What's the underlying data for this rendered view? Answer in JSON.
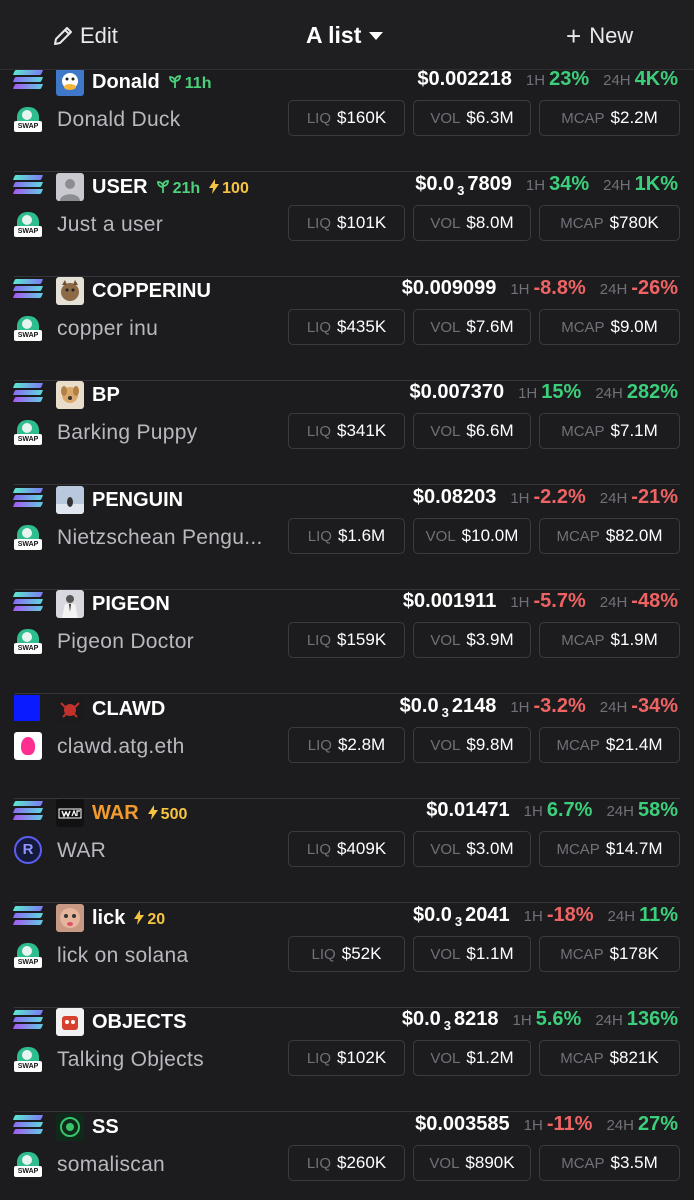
{
  "header": {
    "edit_label": "Edit",
    "list_label": "A list",
    "new_label": "New"
  },
  "labels": {
    "h1": "1H",
    "h24": "24H",
    "liq": "LIQ",
    "vol": "VOL",
    "mcap": "MCAP",
    "swap": "SWAP"
  },
  "tokens": [
    {
      "symbol": "Donald",
      "age": "11h",
      "boost": "",
      "name": "Donald Duck",
      "price_main": "$0.002218",
      "price_sub": "",
      "price_tail": "",
      "h1": "23%",
      "h24": "4K%",
      "liq": "$160K",
      "vol": "$6.3M",
      "mcap": "$2.2M",
      "dex": "swap",
      "chain": "solana"
    },
    {
      "symbol": "USER",
      "age": "21h",
      "boost": "100",
      "name": "Just a user",
      "price_main": "$0.0",
      "price_sub": "3",
      "price_tail": "7809",
      "h1": "34%",
      "h24": "1K%",
      "liq": "$101K",
      "vol": "$8.0M",
      "mcap": "$780K",
      "dex": "swap",
      "chain": "solana"
    },
    {
      "symbol": "COPPERINU",
      "age": "",
      "boost": "",
      "name": "copper inu",
      "price_main": "$0.009099",
      "price_sub": "",
      "price_tail": "",
      "h1": "-8.8%",
      "h24": "-26%",
      "liq": "$435K",
      "vol": "$7.6M",
      "mcap": "$9.0M",
      "dex": "swap",
      "chain": "solana"
    },
    {
      "symbol": "BP",
      "age": "",
      "boost": "",
      "name": "Barking Puppy",
      "price_main": "$0.007370",
      "price_sub": "",
      "price_tail": "",
      "h1": "15%",
      "h24": "282%",
      "liq": "$341K",
      "vol": "$6.6M",
      "mcap": "$7.1M",
      "dex": "swap",
      "chain": "solana"
    },
    {
      "symbol": "PENGUIN",
      "age": "",
      "boost": "",
      "name": "Nietzschean Pengu...",
      "price_main": "$0.08203",
      "price_sub": "",
      "price_tail": "",
      "h1": "-2.2%",
      "h24": "-21%",
      "liq": "$1.6M",
      "vol": "$10.0M",
      "mcap": "$82.0M",
      "dex": "swap",
      "chain": "solana"
    },
    {
      "symbol": "PIGEON",
      "age": "",
      "boost": "",
      "name": "Pigeon Doctor",
      "price_main": "$0.001911",
      "price_sub": "",
      "price_tail": "",
      "h1": "-5.7%",
      "h24": "-48%",
      "liq": "$159K",
      "vol": "$3.9M",
      "mcap": "$1.9M",
      "dex": "swap",
      "chain": "solana"
    },
    {
      "symbol": "CLAWD",
      "age": "",
      "boost": "",
      "name": "clawd.atg.eth",
      "price_main": "$0.0",
      "price_sub": "3",
      "price_tail": "2148",
      "h1": "-3.2%",
      "h24": "-34%",
      "liq": "$2.8M",
      "vol": "$9.8M",
      "mcap": "$21.4M",
      "dex": "uniswap",
      "chain": "base"
    },
    {
      "symbol": "WAR",
      "age": "",
      "boost": "500",
      "name": "WAR",
      "price_main": "$0.01471",
      "price_sub": "",
      "price_tail": "",
      "h1": "6.7%",
      "h24": "58%",
      "liq": "$409K",
      "vol": "$3.0M",
      "mcap": "$14.7M",
      "dex": "raydium",
      "chain": "solana"
    },
    {
      "symbol": "lick",
      "age": "",
      "boost": "20",
      "name": "lick on solana",
      "price_main": "$0.0",
      "price_sub": "3",
      "price_tail": "2041",
      "h1": "-18%",
      "h24": "11%",
      "liq": "$52K",
      "vol": "$1.1M",
      "mcap": "$178K",
      "dex": "swap",
      "chain": "solana"
    },
    {
      "symbol": "OBJECTS",
      "age": "",
      "boost": "",
      "name": "Talking Objects",
      "price_main": "$0.0",
      "price_sub": "3",
      "price_tail": "8218",
      "h1": "5.6%",
      "h24": "136%",
      "liq": "$102K",
      "vol": "$1.2M",
      "mcap": "$821K",
      "dex": "swap",
      "chain": "solana"
    },
    {
      "symbol": "SS",
      "age": "",
      "boost": "",
      "name": "somaliscan",
      "price_main": "$0.003585",
      "price_sub": "",
      "price_tail": "",
      "h1": "-11%",
      "h24": "27%",
      "liq": "$260K",
      "vol": "$890K",
      "mcap": "$3.5M",
      "dex": "swap",
      "chain": "solana"
    }
  ]
}
